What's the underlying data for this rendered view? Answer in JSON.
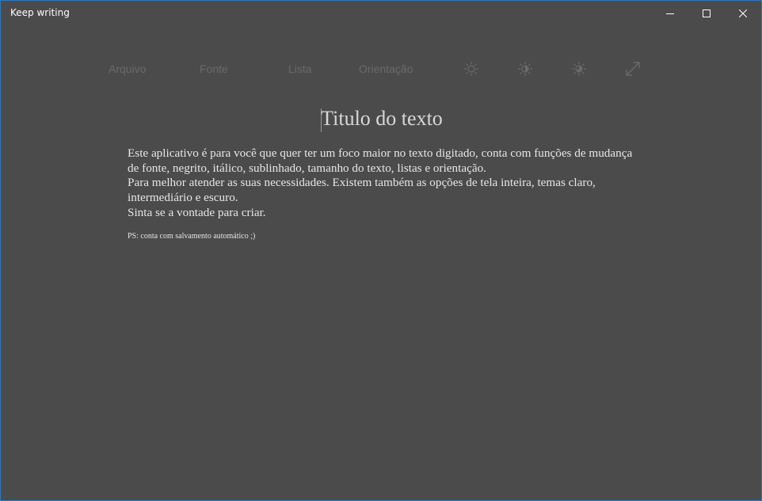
{
  "window": {
    "title": "Keep writing",
    "controls": {
      "minimize_icon": "minimize-icon",
      "maximize_icon": "maximize-icon",
      "close_icon": "close-icon"
    }
  },
  "toolbar": {
    "menu": [
      "Arquivo",
      "Fonte",
      "Lista",
      "Orientação"
    ],
    "icons": [
      "light-theme-icon",
      "medium-theme-icon",
      "dark-theme-icon",
      "fullscreen-icon"
    ],
    "text_color": "#6a6a6a"
  },
  "document": {
    "title": "Titulo do texto",
    "paragraphs": [
      "Este aplicativo é para você que quer ter um foco maior no texto digitado, conta com funções de mudança de fonte, negrito, itálico, sublinhado, tamanho do texto, listas e orientação.",
      "Para melhor atender as suas necessidades. Existem também as opções de tela inteira, temas claro, intermediário e escuro.",
      "Sinta se a vontade para criar."
    ],
    "ps": "PS: conta com salvamento automático ;)"
  },
  "colors": {
    "background": "#4b4b4b",
    "border": "#2b78c5",
    "text": "#e6e6e6"
  }
}
